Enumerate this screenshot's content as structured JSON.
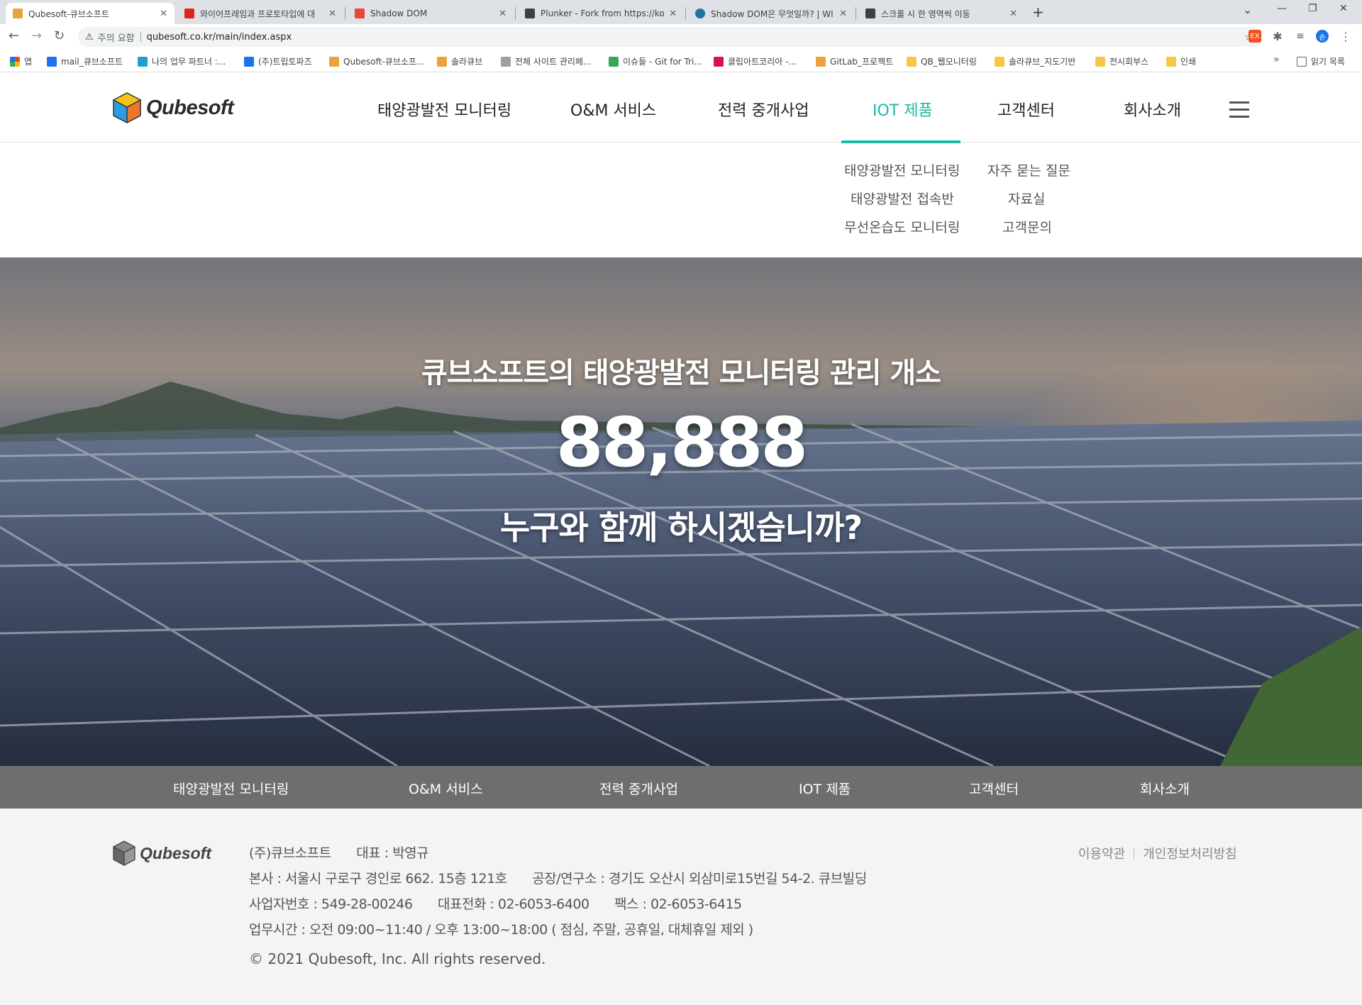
{
  "browser": {
    "tabs": [
      {
        "title": "Qubesoft-큐브소프트",
        "favicon_color": "#e8a33c",
        "active": true
      },
      {
        "title": "와이어프레임과 프로토타입에 대",
        "favicon_color": "#e1251b",
        "active": false
      },
      {
        "title": "Shadow DOM",
        "favicon_color": "#e8453c",
        "active": false
      },
      {
        "title": "Plunker - Fork from https://ko.ja",
        "favicon_color": "#3c4043",
        "active": false
      },
      {
        "title": "Shadow DOM은 무엇일까? | WI",
        "favicon_color": "#21759b",
        "active": false
      },
      {
        "title": "스크롤 시 한 영역씩 이동",
        "favicon_color": "#3c4043",
        "active": false
      }
    ],
    "omnibox": {
      "warning_icon": "⚠",
      "security_label": "주의 요함",
      "url": "qubesoft.co.kr/main/index.aspx"
    },
    "bookmarks": [
      {
        "label": "앱",
        "icon_color": "#ea4335"
      },
      {
        "label": "mail_큐브소프트",
        "icon_color": "#1a73e8"
      },
      {
        "label": "나의 업무 파트너 :...",
        "icon_color": "#1fa0c8"
      },
      {
        "label": "(주)트립토파즈",
        "icon_color": "#1a73e8"
      },
      {
        "label": "Qubesoft-큐브소프...",
        "icon_color": "#e8a33c"
      },
      {
        "label": "솔라큐브",
        "icon_color": "#e8a33c"
      },
      {
        "label": "전체 사이트 관리페...",
        "icon_color": "#9aa0a6"
      },
      {
        "label": "이슈들 - Git for Tri...",
        "icon_color": "#34a853"
      },
      {
        "label": "클립아트코리아 -...",
        "icon_color": "#d60f5b"
      },
      {
        "label": "GitLab_프로젝트",
        "icon_color": "#e8a33c"
      },
      {
        "label": "QB_웹모니터링",
        "icon_color": "#f6c744"
      },
      {
        "label": "솔라큐브_지도기반",
        "icon_color": "#f6c744"
      },
      {
        "label": "전시회부스",
        "icon_color": "#f6c744"
      },
      {
        "label": "인쇄",
        "icon_color": "#f6c744"
      }
    ],
    "reading_list": "읽기 목록",
    "more": "»"
  },
  "header": {
    "logo_text": "Qubesoft",
    "nav": [
      {
        "label": "태양광발전 모니터링",
        "active": false
      },
      {
        "label": "O&M 서비스",
        "active": false
      },
      {
        "label": "전력 중개사업",
        "active": false
      },
      {
        "label": "IOT 제품",
        "active": true
      },
      {
        "label": "고객센터",
        "active": false
      },
      {
        "label": "회사소개",
        "active": false
      }
    ],
    "accent_color": "#19b9a3"
  },
  "dropdown": {
    "iot": [
      "태양광발전 모니터링",
      "태양광발전 접속반",
      "무선온습도 모니터링"
    ],
    "support": [
      "자주 묻는 질문",
      "자료실",
      "고객문의"
    ]
  },
  "hero": {
    "title": "큐브소프트의 태양광발전 모니터링 관리 개소",
    "number": "88,888",
    "question": "누구와 함께 하시겠습니까?"
  },
  "subnav": [
    "태양광발전 모니터링",
    "O&M 서비스",
    "전력 중개사업",
    "IOT 제품",
    "고객센터",
    "회사소개"
  ],
  "footer": {
    "logo_text": "Qubesoft",
    "company": "(주)큐브소프트",
    "ceo": "대표 : 박영규",
    "hq": "본사 : 서울시 구로구 경인로 662. 15층 121호",
    "lab": "공장/연구소 : 경기도 오산시 외삼미로15번길 54-2. 큐브빌딩",
    "biz_no": "사업자번호 : 549-28-00246",
    "tel": "대표전화 : 02-6053-6400",
    "fax": "팩스 : 02-6053-6415",
    "hours": "업무시간 : 오전 09:00~11:40 / 오후 13:00~18:00 ( 점심, 주말, 공휴일, 대체휴일 제외 )",
    "copyright": "© 2021 Qubesoft, Inc. All rights reserved.",
    "links": [
      "이용약관",
      "개인정보처리방침"
    ]
  }
}
